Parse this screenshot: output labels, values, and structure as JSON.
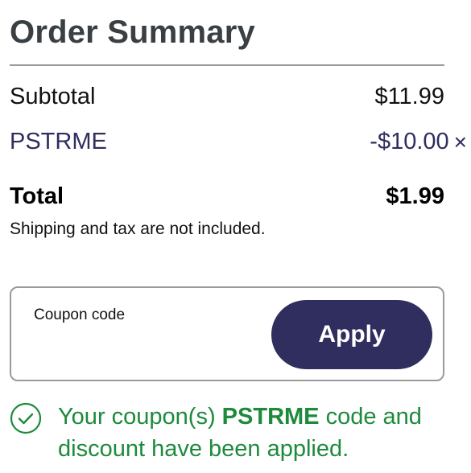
{
  "summary": {
    "title": "Order Summary",
    "subtotal_label": "Subtotal",
    "subtotal_value": "$11.99",
    "coupon_code": "PSTRME",
    "coupon_discount": "-$10.00",
    "remove_icon": "×",
    "total_label": "Total",
    "total_value": "$1.99",
    "note": "Shipping and tax are not included."
  },
  "coupon_form": {
    "label": "Coupon code",
    "value": "",
    "apply_label": "Apply"
  },
  "success": {
    "prefix": "Your coupon(s) ",
    "code": "PSTRME",
    "suffix": " code and discount have been applied."
  },
  "colors": {
    "title": "#3a3f43",
    "accent": "#2f2e5e",
    "success": "#1d8a3c",
    "border": "#9a9a9a"
  },
  "icons": {
    "remove": "close-icon",
    "success": "check-circle-icon"
  }
}
